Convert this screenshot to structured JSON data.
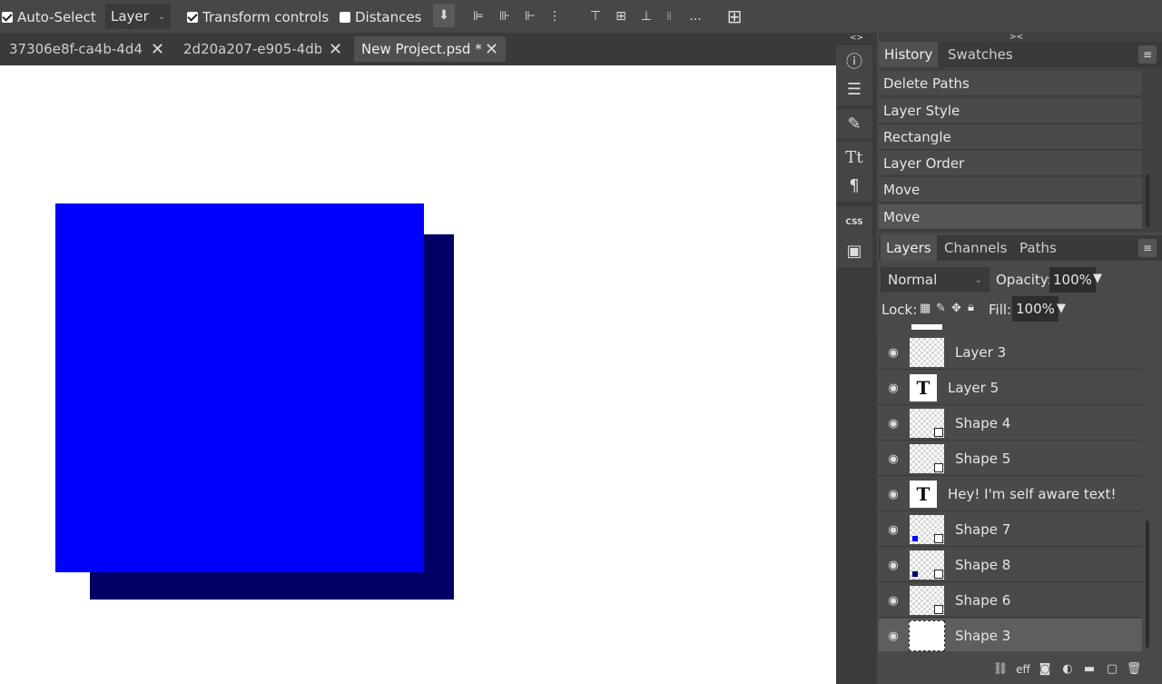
{
  "toolbar": {
    "auto_select_label": "Auto-Select",
    "auto_select_checked": true,
    "layer_select_value": "Layer",
    "transform_controls_label": "Transform controls",
    "transform_controls_checked": true,
    "distances_label": "Distances",
    "distances_checked": false,
    "more_label": "..."
  },
  "tabs": [
    {
      "label": "37306e8f-ca4b-4d4 *",
      "active": false
    },
    {
      "label": "2d20a207-e905-4db *",
      "active": false
    },
    {
      "label": "New Project.psd *",
      "active": true
    }
  ],
  "canvas": {
    "background": "#ffffff",
    "shape_front_color": "#0000ff",
    "shape_back_color": "#000066"
  },
  "toolstrip": {
    "header_left": "<>",
    "header_right": "><",
    "css_label": "CSS"
  },
  "history": {
    "tabs": [
      "History",
      "Swatches"
    ],
    "items": [
      "Delete Paths",
      "Layer Style",
      "Rectangle",
      "Layer Order",
      "Move",
      "Move"
    ]
  },
  "layers_panel": {
    "tabs": [
      "Layers",
      "Channels",
      "Paths"
    ],
    "blend_mode": "Normal",
    "opacity_label": "Opacity:",
    "opacity_value": "100%",
    "lock_label": "Lock:",
    "fill_label": "Fill:",
    "fill_value": "100%",
    "layers": [
      {
        "name": "Layer 3",
        "kind": "raster"
      },
      {
        "name": "Layer 5",
        "kind": "text"
      },
      {
        "name": "Shape 4",
        "kind": "shape"
      },
      {
        "name": "Shape 5",
        "kind": "shape"
      },
      {
        "name": "Hey! I'm self aware text!",
        "kind": "text"
      },
      {
        "name": "Shape 7",
        "kind": "shape"
      },
      {
        "name": "Shape 8",
        "kind": "shape"
      },
      {
        "name": "Shape 6",
        "kind": "shape"
      },
      {
        "name": "Shape 3",
        "kind": "shape",
        "selected": true
      }
    ]
  }
}
